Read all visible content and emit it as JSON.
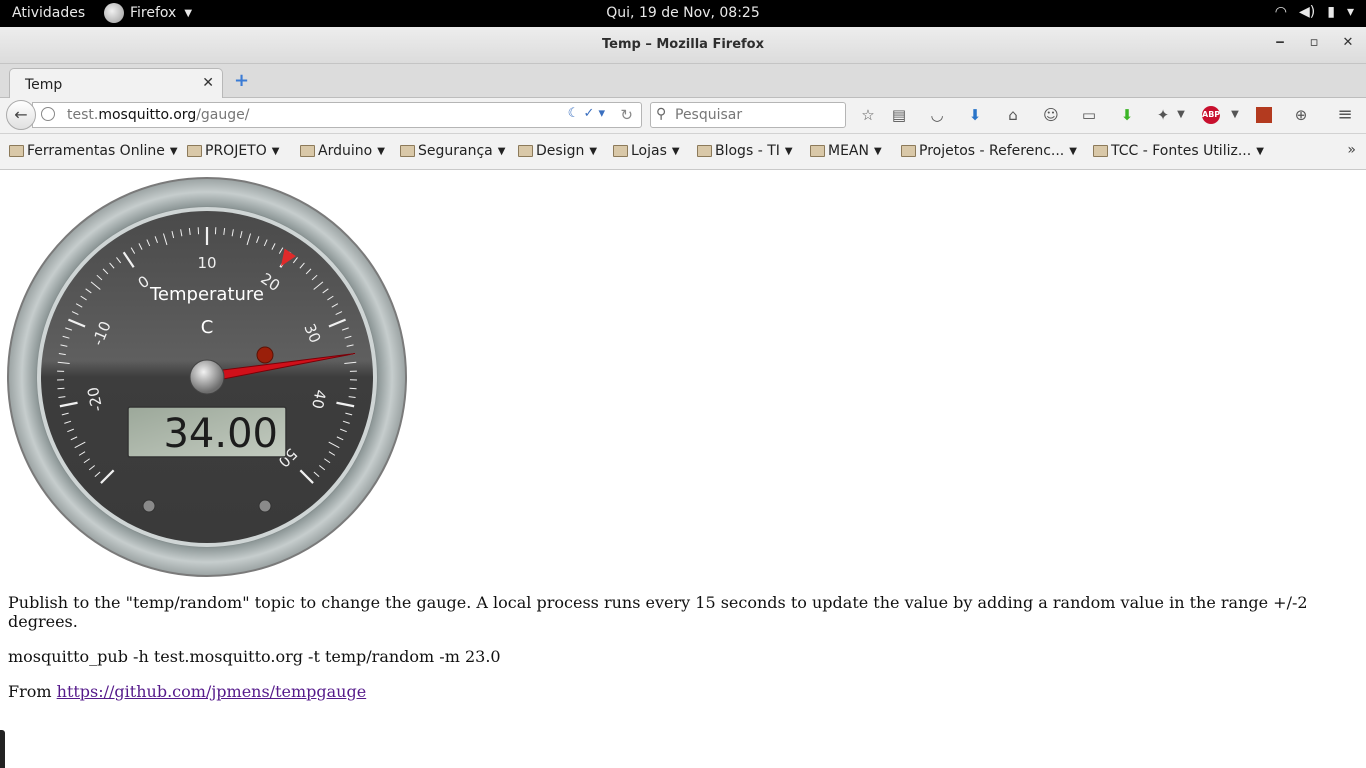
{
  "topbar": {
    "activities": "Atividades",
    "app_name": "Firefox",
    "clock": "Qui, 19 de Nov, 08:25",
    "tray_icons": [
      "wifi-icon",
      "volume-icon",
      "battery-icon",
      "power-menu-icon"
    ]
  },
  "window": {
    "title": "Temp – Mozilla Firefox",
    "minimize": "‒",
    "maximize": "▫",
    "close": "✕"
  },
  "tabs": [
    {
      "label": "Temp",
      "close": "✕"
    }
  ],
  "new_tab": "+",
  "nav": {
    "url_prefix": "test.",
    "url_domain": "mosquitto.org",
    "url_path": "/gauge/",
    "search_placeholder": "Pesquisar"
  },
  "toolbar_icons": [
    "bookmark-star-icon",
    "reading-list-icon",
    "pocket-icon",
    "downloads-icon",
    "home-icon",
    "chat-icon",
    "keyboard-icon",
    "download-helper-icon",
    "extension-icon",
    "adblock-plus-icon",
    "extension-square-icon",
    "globe-icon",
    "hamburger-menu-icon"
  ],
  "abp_label": "ABP",
  "bookmarks": [
    {
      "label": "Ferramentas Online"
    },
    {
      "label": "PROJETO"
    },
    {
      "label": "Arduino"
    },
    {
      "label": "Segurança"
    },
    {
      "label": "Design"
    },
    {
      "label": "Lojas"
    },
    {
      "label": "Blogs - TI"
    },
    {
      "label": "MEAN"
    },
    {
      "label": "Projetos - Referenc..."
    },
    {
      "label": "TCC - Fontes Utiliz..."
    }
  ],
  "bookmarks_overflow": "»",
  "gauge": {
    "title": "Temperature",
    "units": "C",
    "value": 34.0,
    "display": "34.00",
    "min": -30,
    "max": 50,
    "major_ticks": [
      "-20",
      "-10",
      "0",
      "10",
      "20",
      "30",
      "40",
      "50"
    ],
    "high_marker": 20
  },
  "content": {
    "paragraph1": "Publish to the \"temp/random\" topic to change the gauge. A local process runs every 15 seconds to update the value by adding a random value in the range +/-2 degrees.",
    "command": "mosquitto_pub -h test.mosquitto.org -t temp/random -m 23.0",
    "from_label": "From ",
    "link_text": "https://github.com/jpmens/tempgauge"
  }
}
